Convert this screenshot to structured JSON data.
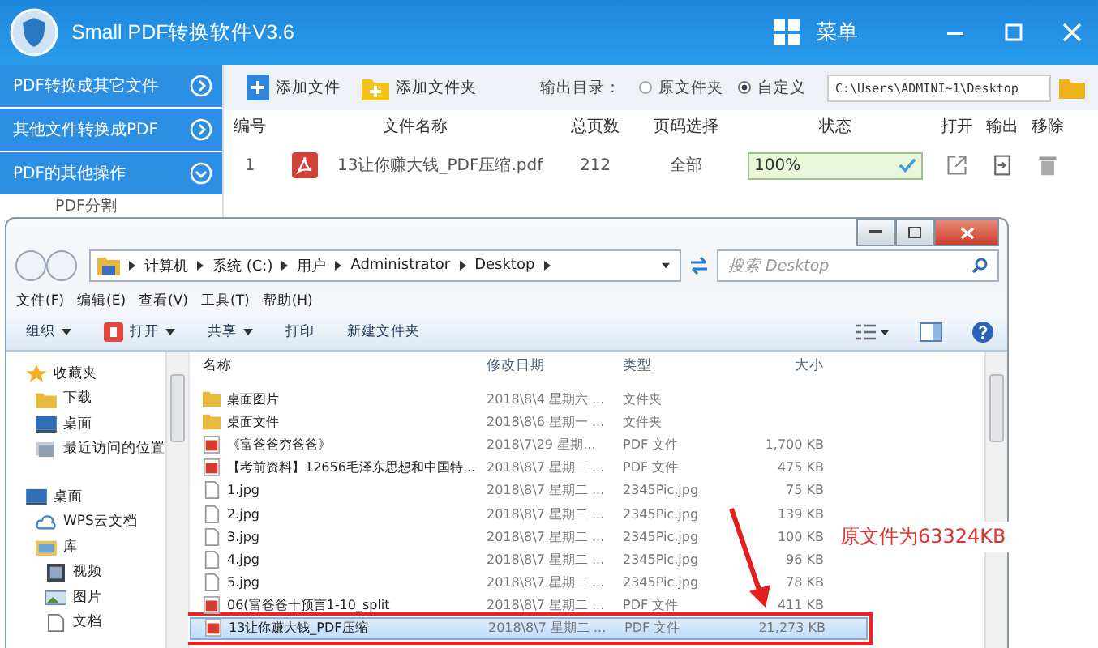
{
  "app": {
    "title": "Small PDF转换软件V3.6",
    "menu_label": "菜单"
  },
  "sidebar": [
    {
      "label": "PDF转换成其它文件",
      "expanded": false
    },
    {
      "label": "其他文件转换成PDF",
      "expanded": false
    },
    {
      "label": "PDF的其他操作",
      "expanded": true,
      "children": [
        {
          "label": "PDF分割"
        }
      ]
    }
  ],
  "toolbar": {
    "add_file": "添加文件",
    "add_folder": "添加文件夹",
    "output_label": "输出目录：",
    "options": [
      {
        "label": "原文件夹",
        "selected": false
      },
      {
        "label": "自定义",
        "selected": true
      }
    ],
    "path": "C:\\Users\\ADMINI~1\\Desktop"
  },
  "table": {
    "columns": [
      "编号",
      "文件名称",
      "总页数",
      "页码选择",
      "状态",
      "打开",
      "输出",
      "移除"
    ],
    "rows": [
      {
        "index": "1",
        "name": "13让你赚大钱_PDF压缩.pdf",
        "pages": "212",
        "range": "全部",
        "status": "100%",
        "level": 1
      }
    ]
  },
  "explorer": {
    "breadcrumbs": [
      "计算机",
      "系统 (C:)",
      "用户",
      "Administrator",
      "Desktop"
    ],
    "search_placeholder": "搜索 Desktop",
    "menu": [
      "文件(F)",
      "编辑(E)",
      "查看(V)",
      "工具(T)",
      "帮助(H)"
    ],
    "commands": [
      {
        "label": "组织",
        "kind": "plain",
        "dropdown": true
      },
      {
        "label": "打开",
        "kind": "app",
        "dropdown": true
      },
      {
        "label": "共享",
        "kind": "plain",
        "dropdown": true
      },
      {
        "label": "打印",
        "kind": "plain",
        "dropdown": false
      },
      {
        "label": "新建文件夹",
        "kind": "plain",
        "dropdown": false
      }
    ],
    "nav": [
      {
        "label": "收藏夹",
        "kind": "favorites",
        "children": [
          {
            "label": "下载",
            "kind": "download"
          },
          {
            "label": "桌面",
            "kind": "desktop"
          },
          {
            "label": "最近访问的位置",
            "kind": "recent"
          }
        ]
      },
      {
        "label": "桌面",
        "kind": "desktop",
        "children": [
          {
            "label": "WPS云文档",
            "kind": "cloud"
          },
          {
            "label": "库",
            "kind": "library",
            "children": [
              {
                "label": "视频",
                "kind": "video"
              },
              {
                "label": "图片",
                "kind": "image"
              },
              {
                "label": "文档",
                "kind": "document"
              }
            ]
          }
        ]
      }
    ],
    "columns": [
      "名称",
      "修改日期",
      "类型",
      "大小"
    ],
    "files": [
      {
        "name": "桌面图片",
        "date": "2018\\8\\4 星期六 ...",
        "type": "文件夹",
        "kind": "folder",
        "selected": false
      },
      {
        "name": "桌面文件",
        "date": "2018\\8\\6 星期一 ...",
        "type": "文件夹",
        "kind": "folder",
        "selected": false
      },
      {
        "name": "《富爸爸穷爸爸》",
        "date": "2018\\7\\29 星期...",
        "type": "PDF 文件",
        "size": "1,700 KB",
        "kind": "pdf",
        "selected": false
      },
      {
        "name": "【考前资料】12656毛泽东思想和中国特...",
        "date": "2018\\8\\7 星期二 ...",
        "type": "PDF 文件",
        "size": "475 KB",
        "kind": "pdf",
        "selected": false
      },
      {
        "name": "1.jpg",
        "date": "2018\\8\\7 星期二 ...",
        "type": "2345Pic.jpg",
        "size": "75 KB",
        "kind": "image",
        "selected": false
      },
      {
        "name": "2.jpg",
        "date": "2018\\8\\7 星期二 ...",
        "type": "2345Pic.jpg",
        "size": "139 KB",
        "kind": "image",
        "selected": false
      },
      {
        "name": "3.jpg",
        "date": "2018\\8\\7 星期二 ...",
        "type": "2345Pic.jpg",
        "size": "100 KB",
        "kind": "image",
        "selected": false
      },
      {
        "name": "4.jpg",
        "date": "2018\\8\\7 星期二 ...",
        "type": "2345Pic.jpg",
        "size": "96 KB",
        "kind": "image",
        "selected": false
      },
      {
        "name": "5.jpg",
        "date": "2018\\8\\7 星期二 ...",
        "type": "2345Pic.jpg",
        "size": "78 KB",
        "kind": "image",
        "selected": false
      },
      {
        "name": "06(富爸爸十预言1-10_split",
        "date": "2018\\8\\7 星期二 ...",
        "type": "PDF 文件",
        "size": "411 KB",
        "kind": "pdf",
        "selected": false
      },
      {
        "name": "13让你赚大钱_PDF压缩",
        "date": "2018\\8\\7 星期二 ...",
        "type": "PDF 文件",
        "size": "21,273 KB",
        "kind": "pdf",
        "selected": true
      }
    ]
  },
  "annotation": {
    "text": "原文件为63324KB"
  }
}
